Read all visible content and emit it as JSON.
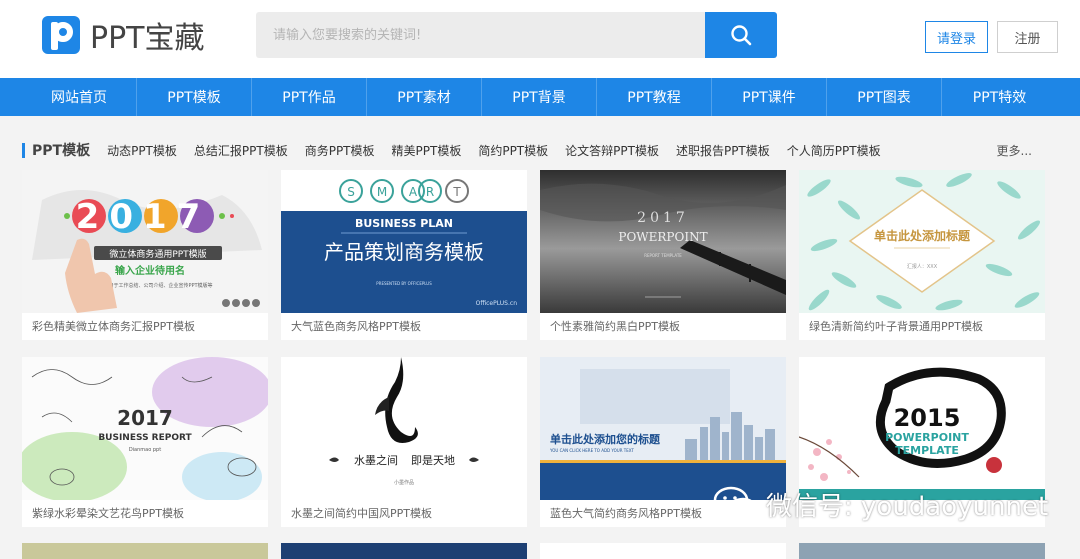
{
  "header": {
    "logo_text": "PPT宝藏",
    "search_placeholder": "请输入您要搜索的关键词!",
    "login_label": "请登录",
    "register_label": "注册"
  },
  "nav": {
    "items": [
      "网站首页",
      "PPT模板",
      "PPT作品",
      "PPT素材",
      "PPT背景",
      "PPT教程",
      "PPT课件",
      "PPT图表",
      "PPT特效"
    ]
  },
  "category": {
    "title": "PPT模板",
    "links": [
      "动态PPT模板",
      "总结汇报PPT模板",
      "商务PPT模板",
      "精美PPT模板",
      "简约PPT模板",
      "论文答辩PPT模板",
      "述职报告PPT模板",
      "个人简历PPT模板"
    ],
    "more": "更多..."
  },
  "cards": [
    {
      "title": "彩色精美微立体商务汇报PPT模板",
      "thumb": {
        "big": "2017",
        "line1": "微立体商务通用PPT模版",
        "line2": "输入企业待用名",
        "line3": "适用于工作总结、公司介绍、企业宣传PPT模版等"
      }
    },
    {
      "title": "大气蓝色商务风格PPT模板",
      "thumb": {
        "letters": [
          "S",
          "M",
          "A",
          "R",
          "T"
        ],
        "line1": "BUSINESS PLAN",
        "line2": "产品策划商务模板",
        "line3": "PRESENTED BY OFFICEPLUS",
        "brand": "OfficePLUS.cn"
      }
    },
    {
      "title": "个性素雅简约黑白PPT模板",
      "thumb": {
        "line1": "2017",
        "line2": "POWERPOINT",
        "line3": "REPORT TEMPLATE"
      }
    },
    {
      "title": "绿色清新简约叶子背景通用PPT模板",
      "thumb": {
        "line1": "单击此处添加标题",
        "line2": "汇报人：XXX"
      }
    },
    {
      "title": "紫绿水彩晕染文艺花鸟PPT模板",
      "thumb": {
        "line1": "2017",
        "line2": "BUSINESS REPORT",
        "line3": "Dianmao ppt"
      }
    },
    {
      "title": "水墨之间简约中国风PPT模板",
      "thumb": {
        "line1": "水墨之间",
        "line2": "即是天地",
        "line3": "小墨作品"
      }
    },
    {
      "title": "蓝色大气简约商务风格PPT模板",
      "thumb": {
        "line1": "单击此处添加您的标题",
        "line2": "YOU CAN CLICK HERE TO ADD YOUR TEXT"
      }
    },
    {
      "title": "",
      "thumb": {
        "line1": "2015",
        "line2": "POWERPOINT",
        "line3": "TEMPLATE"
      }
    }
  ],
  "watermark": {
    "text": "微信号: youdaoyunnet"
  },
  "colors": {
    "brand": "#1e86e6",
    "nav": "#1e86e6",
    "page_bg": "#f3f3f3"
  }
}
